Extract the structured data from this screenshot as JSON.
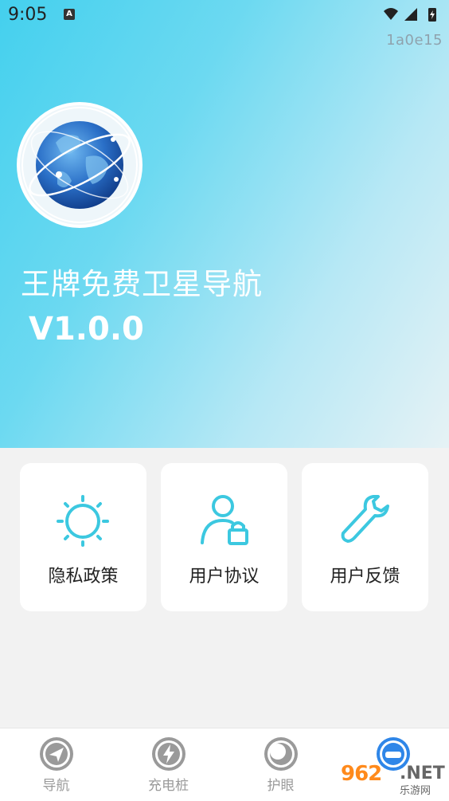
{
  "status_bar": {
    "time": "9:05",
    "notification_icon": "A"
  },
  "build_tag": "1a0e15",
  "app": {
    "title": "王牌免费卫星导航",
    "version": "V1.0.0"
  },
  "cards": [
    {
      "label": "隐私政策",
      "icon": "sun-icon"
    },
    {
      "label": "用户协议",
      "icon": "user-lock-icon"
    },
    {
      "label": "用户反馈",
      "icon": "wrench-icon"
    }
  ],
  "tabs": [
    {
      "label": "导航",
      "icon": "navigation-icon"
    },
    {
      "label": "充电桩",
      "icon": "charging-icon"
    },
    {
      "label": "护眼",
      "icon": "eye-care-icon"
    },
    {
      "label": "",
      "icon": "about-icon",
      "active": true
    }
  ],
  "watermark": {
    "number": "962",
    "suffix": ".NET",
    "sub": "乐游网"
  },
  "colors": {
    "accent": "#3cc8e0",
    "hero_start": "#44d0ee",
    "hero_end": "#e6f2f5"
  }
}
